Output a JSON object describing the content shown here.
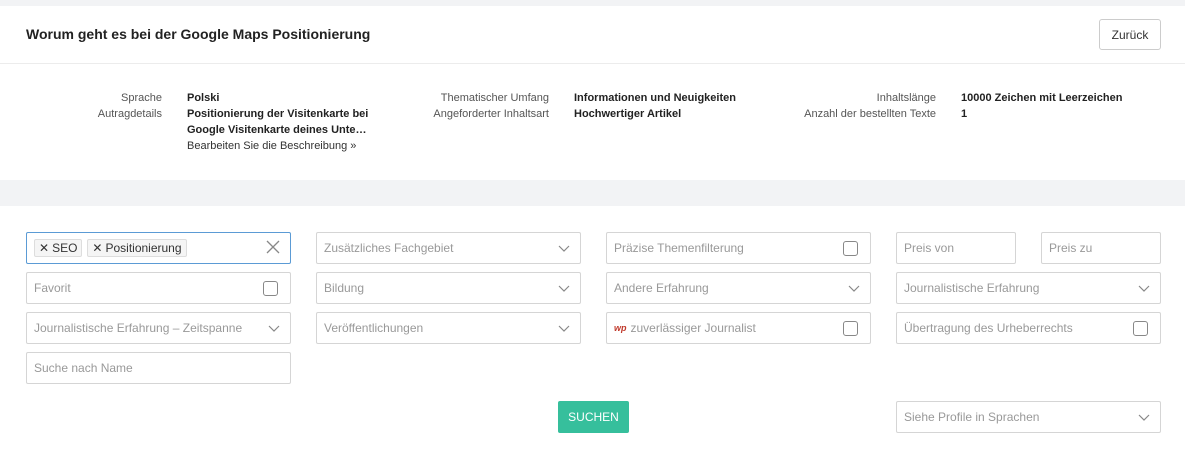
{
  "header": {
    "title": "Worum geht es bei der Google Maps Positionierung",
    "back_label": "Zurück"
  },
  "details": {
    "language_label": "Sprache",
    "language_value": "Polski",
    "order_details_label": "Autragdetails",
    "order_details_line1": "Positionierung der Visitenkarte bei",
    "order_details_line2": "Google Visitenkarte deines Unte…",
    "edit_link": "Bearbeiten Sie die Beschreibung »",
    "scope_label": "Thematischer Umfang",
    "scope_value": "Informationen und Neuigkeiten",
    "content_type_label": "Angeforderter Inhaltsart",
    "content_type_value": "Hochwertiger Artikel",
    "length_label": "Inhaltslänge",
    "length_value": "10000 Zeichen mit Leerzeichen",
    "count_label": "Anzahl der bestellten Texte",
    "count_value": "1"
  },
  "filters": {
    "tags": [
      "SEO",
      "Positionierung"
    ],
    "additional_field": "Zusätzliches Fachgebiet",
    "precise_topic": "Präzise Themenfilterung",
    "price_from": "Preis von",
    "price_to": "Preis zu",
    "favorite": "Favorit",
    "education": "Bildung",
    "other_experience": "Andere Erfahrung",
    "journalistic_experience": "Journalistische Erfahrung",
    "journalistic_period": "Journalistische Erfahrung – Zeitspanne",
    "publications": "Veröffentlichungen",
    "wp_badge": "wp",
    "reliable_journalist": "zuverlässiger Journalist",
    "copyright_transfer": "Übertragung des Urheberrechts",
    "search_by_name": "Suche nach Name",
    "search_button": "SUCHEN",
    "profile_languages": "Siehe Profile in Sprachen"
  },
  "colors": {
    "accent": "#36bf9c",
    "active_border": "#5b9bd5"
  }
}
